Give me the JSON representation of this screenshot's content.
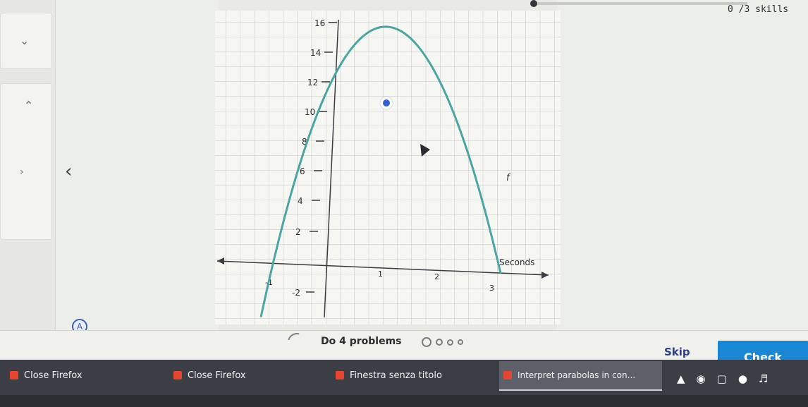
{
  "header": {
    "skills_label": "0 /3 skills",
    "progress": 0.0
  },
  "left_panel": {
    "chevrons": [
      "chevron-down-icon",
      "chevron-up-icon",
      "chevron-right-icon",
      "chevron-left-icon"
    ]
  },
  "graph": {
    "y_ticks": [
      "16",
      "14",
      "12",
      "10",
      "8",
      "6",
      "4",
      "2",
      "-2"
    ],
    "x_ticks": [
      "-1",
      "1",
      "2",
      "3"
    ],
    "x_axis_label": "Seconds",
    "curve_label": "f",
    "curve_color": "#4aa6a6",
    "point_color": "#2f63d8"
  },
  "footer": {
    "problems_text": "Do 4 problems",
    "skip_label": "Skip",
    "check_label": "Check",
    "check_color": "#1a86d6"
  },
  "taskbar": {
    "items": [
      {
        "label": "Close Firefox"
      },
      {
        "label": "Close Firefox"
      },
      {
        "label": "Finestra senza titolo"
      },
      {
        "label": "Interpret parabolas in con..."
      }
    ]
  }
}
